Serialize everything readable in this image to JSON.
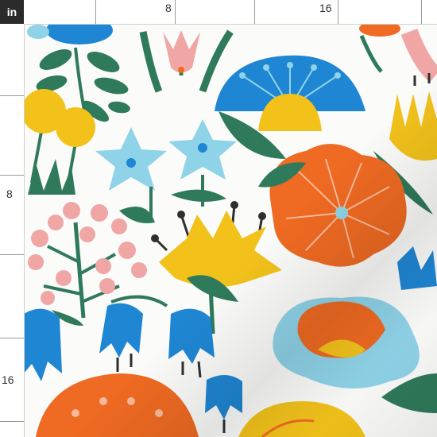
{
  "ruler": {
    "unit": "in",
    "top_labels": [
      "8",
      "16"
    ],
    "left_labels": [
      "8",
      "16"
    ]
  },
  "pattern": {
    "motif": "folk-art-floral",
    "colors": {
      "cobalt_blue": "#1f86d3",
      "sky_blue": "#8fd3e8",
      "orange": "#ef6a22",
      "mustard_yellow": "#f2c21b",
      "blush_pink": "#f0a6a4",
      "leaf_green": "#2f7a5b",
      "charcoal": "#2f2f2f"
    }
  }
}
